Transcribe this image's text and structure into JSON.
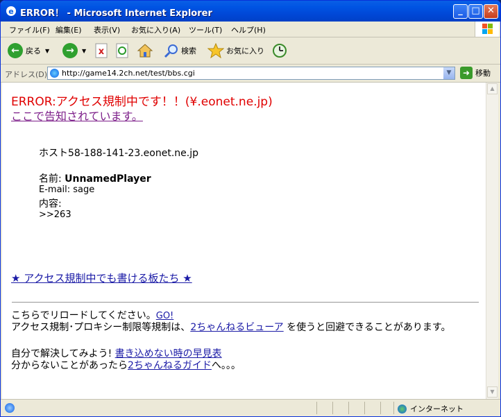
{
  "window": {
    "title": "ERROR！ - Microsoft Internet Explorer",
    "minimize": "_",
    "maximize": "□",
    "close": "✕"
  },
  "menu": [
    "ファイル(F)",
    "編集(E)",
    "表示(V)",
    "お気に入り(A)",
    "ツール(T)",
    "ヘルプ(H)"
  ],
  "toolbar": {
    "back": "戻る",
    "search": "検索",
    "favorites": "お気に入り"
  },
  "address": {
    "label": "アドレス(D)",
    "url": "http://game14.2ch.net/test/bbs.cgi",
    "go": "移動"
  },
  "page": {
    "error_title": "ERROR:アクセス規制中です！！(¥.eonet.ne.jp)",
    "notice_link": "ここで告知されています。",
    "host_label": "ホスト",
    "host_value": "58-188-141-23.eonet.ne.jp",
    "name_label": "名前: ",
    "name_value": "UnnamedPlayer",
    "email_line": "E-mail: sage",
    "content_label": "内容:",
    "content_value": ">>263",
    "boards_link": "★ アクセス規制中でも書ける板たち ★",
    "reload_text": "こちらでリロードしてください。",
    "go_link": "GO!",
    "proxy_text_1": "アクセス規制･プロキシー制限等規制は、",
    "viewer_link": "2ちゃんねるビューア",
    "proxy_text_2": " を使うと回避できることがあります。",
    "self_solve_text": "自分で解決してみよう! ",
    "quick_ref_link": "書き込めない時の早見表",
    "unknown_text": "分からないことがあったら",
    "guide_link": "2ちゃんねるガイド",
    "unknown_tail": "へ。。。"
  },
  "status": {
    "zone": "インターネット"
  }
}
